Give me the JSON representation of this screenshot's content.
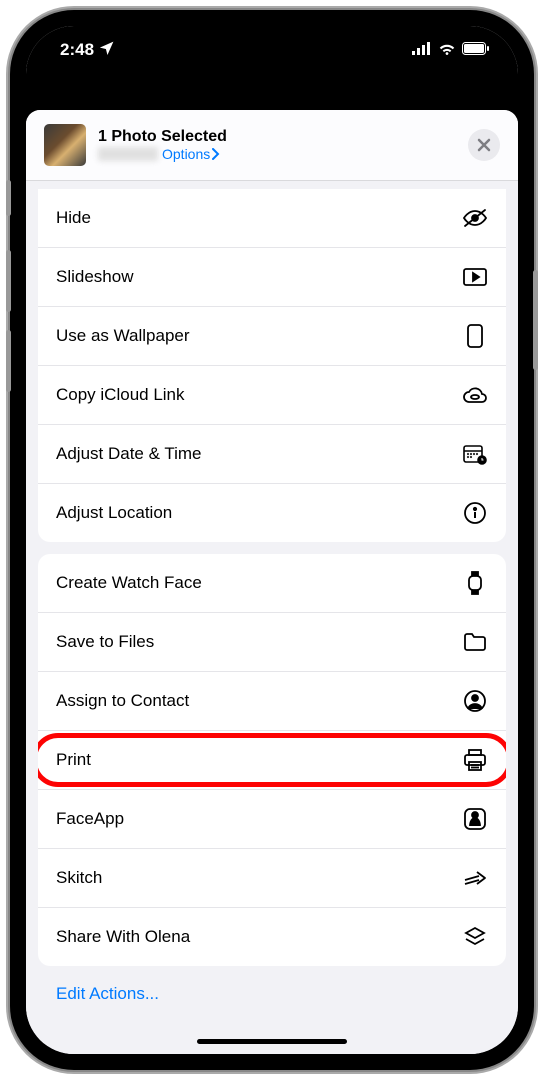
{
  "status": {
    "time": "2:48",
    "location_icon": "location-arrow"
  },
  "sheet": {
    "title": "1 Photo Selected",
    "options_label": "Options"
  },
  "groups": [
    {
      "rows": [
        {
          "label": "Hide",
          "icon": "eye-slash"
        },
        {
          "label": "Slideshow",
          "icon": "play-rect"
        },
        {
          "label": "Use as Wallpaper",
          "icon": "phone-outline"
        },
        {
          "label": "Copy iCloud Link",
          "icon": "cloud-link"
        },
        {
          "label": "Adjust Date & Time",
          "icon": "calendar-clock"
        },
        {
          "label": "Adjust Location",
          "icon": "info-circle"
        }
      ]
    },
    {
      "rows": [
        {
          "label": "Create Watch Face",
          "icon": "watch"
        },
        {
          "label": "Save to Files",
          "icon": "folder"
        },
        {
          "label": "Assign to Contact",
          "icon": "person-circle"
        },
        {
          "label": "Print",
          "icon": "printer",
          "highlight": true
        },
        {
          "label": "FaceApp",
          "icon": "face-app"
        },
        {
          "label": "Skitch",
          "icon": "skitch-arrow"
        },
        {
          "label": "Share With Olena",
          "icon": "layers"
        }
      ]
    }
  ],
  "edit_actions_label": "Edit Actions..."
}
